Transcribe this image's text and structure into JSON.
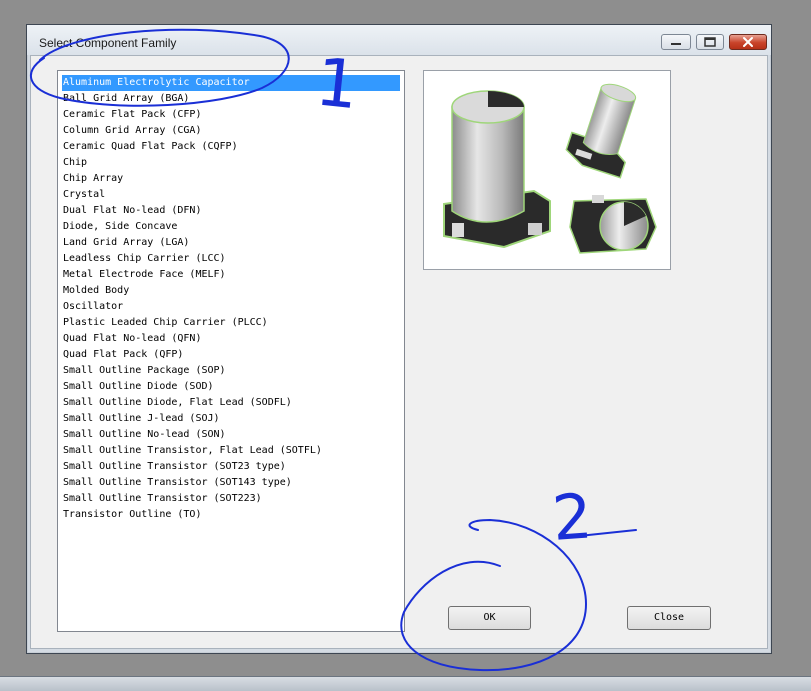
{
  "window": {
    "title": "Select Component Family"
  },
  "titlebar_buttons": {
    "minimize_icon": "minimize-icon",
    "maximize_icon": "maximize-icon",
    "close_icon": "close-icon"
  },
  "component_list": {
    "selected_index": 0,
    "items": [
      "Aluminum Electrolytic Capacitor",
      "Ball Grid Array (BGA)",
      "Ceramic Flat Pack (CFP)",
      "Column Grid Array (CGA)",
      "Ceramic Quad Flat Pack (CQFP)",
      "Chip",
      "Chip Array",
      "Crystal",
      "Dual Flat No-lead (DFN)",
      "Diode, Side Concave",
      "Land Grid Array (LGA)",
      "Leadless Chip Carrier (LCC)",
      "Metal Electrode Face (MELF)",
      "Molded Body",
      "Oscillator",
      "Plastic Leaded Chip Carrier (PLCC)",
      "Quad Flat No-lead (QFN)",
      "Quad Flat Pack (QFP)",
      "Small Outline Package (SOP)",
      "Small Outline Diode (SOD)",
      "Small Outline Diode, Flat Lead (SODFL)",
      "Small Outline J-lead (SOJ)",
      "Small Outline No-lead (SON)",
      "Small Outline Transistor, Flat Lead (SOTFL)",
      "Small Outline Transistor (SOT23 type)",
      "Small Outline Transistor (SOT143 type)",
      "Small Outline Transistor (SOT223)",
      "Transistor Outline (TO)"
    ]
  },
  "buttons": {
    "ok_label": "OK",
    "close_label": "Close"
  },
  "colors": {
    "selection": "#3399ff",
    "annotation_ink": "#1a2fd6"
  },
  "annotations": {
    "marker_1": "1",
    "marker_2": "2"
  }
}
